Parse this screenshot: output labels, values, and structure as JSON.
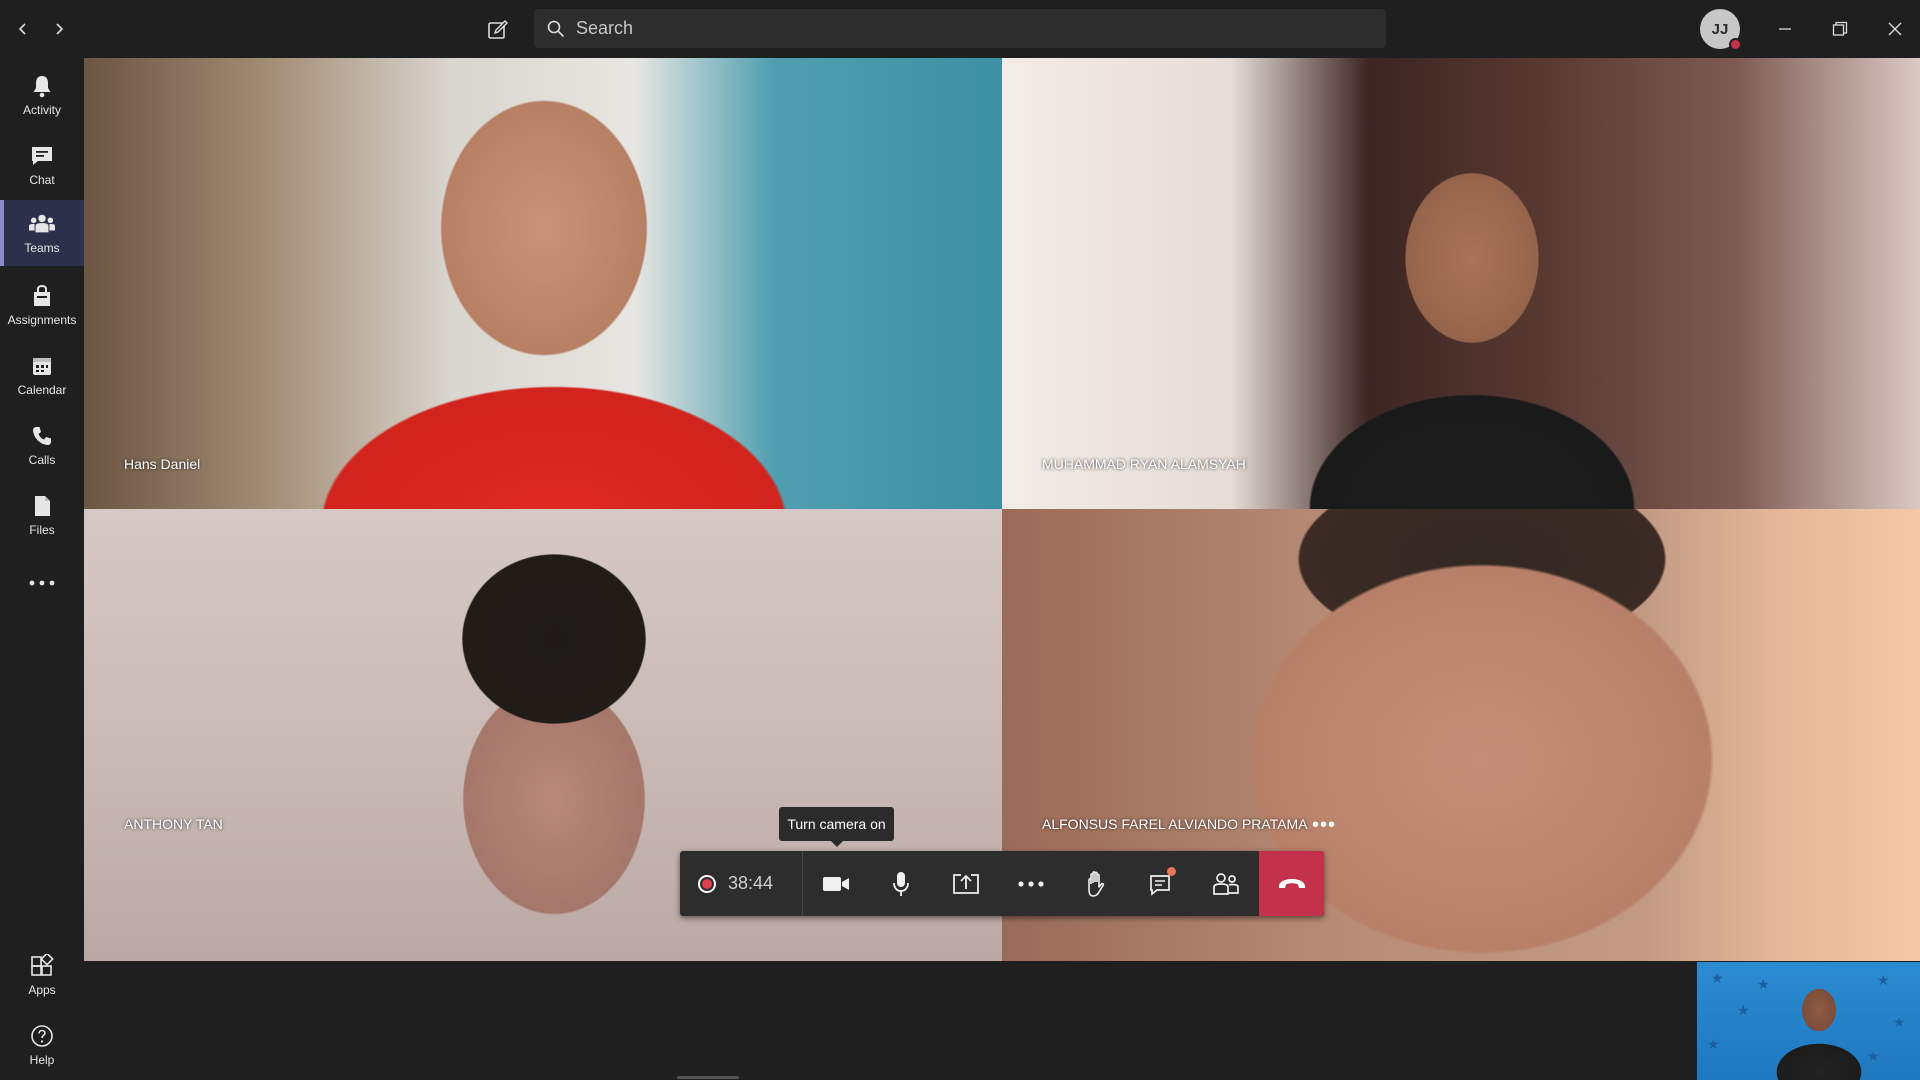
{
  "titlebar": {
    "search_placeholder": "Search",
    "avatar_initials": "JJ"
  },
  "rail": {
    "items": [
      {
        "label": "Activity",
        "icon": "bell-icon"
      },
      {
        "label": "Chat",
        "icon": "chat-icon"
      },
      {
        "label": "Teams",
        "icon": "teams-icon",
        "active": true
      },
      {
        "label": "Assignments",
        "icon": "assignments-icon"
      },
      {
        "label": "Calendar",
        "icon": "calendar-icon"
      },
      {
        "label": "Calls",
        "icon": "phone-icon"
      },
      {
        "label": "Files",
        "icon": "files-icon"
      }
    ],
    "bottom": [
      {
        "label": "Apps",
        "icon": "apps-icon"
      },
      {
        "label": "Help",
        "icon": "help-icon"
      }
    ]
  },
  "participants": [
    {
      "name": "Hans Daniel"
    },
    {
      "name": "MUHAMMAD RYAN ALAMSYAH"
    },
    {
      "name": "ANTHONY TAN"
    },
    {
      "name": "ALFONSUS FAREL ALVIANDO PRATAMA"
    }
  ],
  "callbar": {
    "timer": "38:44",
    "tooltip": "Turn camera on"
  },
  "colors": {
    "accent": "#8b8cc7",
    "hangup": "#c4314b",
    "record": "#e03f4f",
    "background": "#1f1f1f"
  }
}
